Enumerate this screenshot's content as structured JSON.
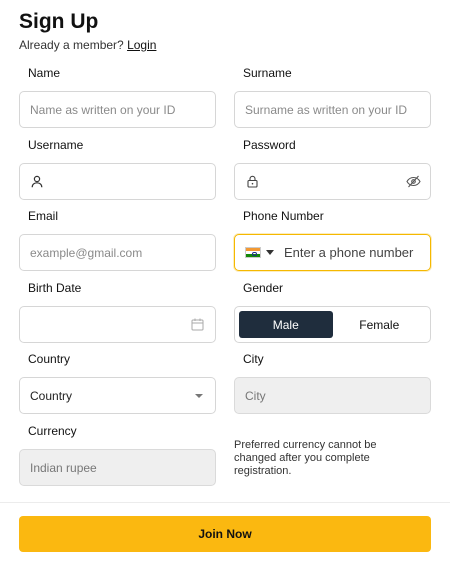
{
  "header": {
    "title": "Sign Up",
    "already_member": "Already a member?",
    "login_link": "Login"
  },
  "fields": {
    "name": {
      "label": "Name",
      "placeholder": "Name as written on your ID"
    },
    "surname": {
      "label": "Surname",
      "placeholder": "Surname as written on your ID"
    },
    "username": {
      "label": "Username",
      "placeholder": ""
    },
    "password": {
      "label": "Password",
      "placeholder": ""
    },
    "email": {
      "label": "Email",
      "placeholder": "example@gmail.com"
    },
    "phone": {
      "label": "Phone Number",
      "placeholder": "Enter a phone number",
      "country_flag": "india-flag-icon"
    },
    "birth_date": {
      "label": "Birth Date",
      "placeholder": ""
    },
    "gender": {
      "label": "Gender",
      "options": [
        "Male",
        "Female"
      ],
      "selected": "Male"
    },
    "country": {
      "label": "Country",
      "value": "Country"
    },
    "city": {
      "label": "City",
      "value": "City"
    },
    "currency": {
      "label": "Currency",
      "value": "Indian rupee"
    }
  },
  "currency_note": "Preferred currency cannot be changed after you complete registration.",
  "submit_label": "Join Now",
  "colors": {
    "accent": "#fbb810",
    "toggle_active": "#1f2d3d",
    "focus_border": "#f5b800",
    "disabled_bg": "#efefef"
  }
}
